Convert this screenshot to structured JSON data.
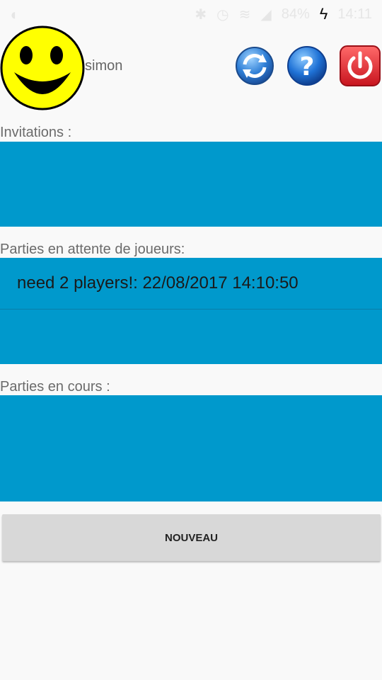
{
  "status_bar": {
    "battery_percent": "84%",
    "time": "14:11"
  },
  "header": {
    "username": "simon",
    "avatar_icon": "smiley-face-icon",
    "refresh_icon": "refresh-icon",
    "help_icon": "help-icon",
    "power_icon": "power-icon"
  },
  "sections": {
    "invitations": {
      "label": "Invitations :"
    },
    "waiting": {
      "label": "Parties en attente de joueurs:",
      "items": [
        "need 2 players!: 22/08/2017 14:10:50"
      ]
    },
    "ongoing": {
      "label": "Parties en cours :"
    }
  },
  "actions": {
    "new_label": "NOUVEAU"
  },
  "colors": {
    "panel": "#0099cc",
    "background": "#f9f9f9",
    "button": "#d8d8d8"
  }
}
